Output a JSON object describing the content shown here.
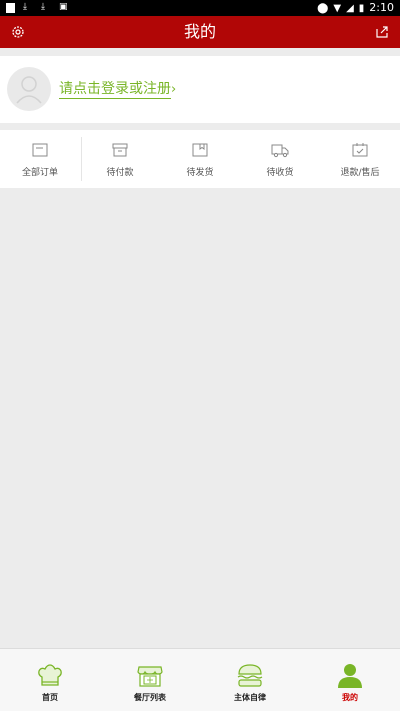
{
  "status_bar": {
    "time": "2:10"
  },
  "header": {
    "title": "我的"
  },
  "login": {
    "prompt": "请点击登录或注册"
  },
  "orders": [
    {
      "label": "全部订单",
      "icon": "all-orders-icon"
    },
    {
      "label": "待付款",
      "icon": "pending-payment-icon"
    },
    {
      "label": "待发货",
      "icon": "pending-shipment-icon"
    },
    {
      "label": "待收货",
      "icon": "pending-receipt-icon"
    },
    {
      "label": "退款/售后",
      "icon": "refund-icon"
    }
  ],
  "bottom_nav": [
    {
      "label": "首页",
      "icon": "chef-hat-icon"
    },
    {
      "label": "餐厅列表",
      "icon": "restaurant-icon"
    },
    {
      "label": "主体自律",
      "icon": "burger-icon"
    },
    {
      "label": "我的",
      "icon": "user-icon",
      "active": true
    }
  ],
  "colors": {
    "header": "#b10606",
    "accent_green": "#79b527",
    "active": "#cc0000"
  }
}
